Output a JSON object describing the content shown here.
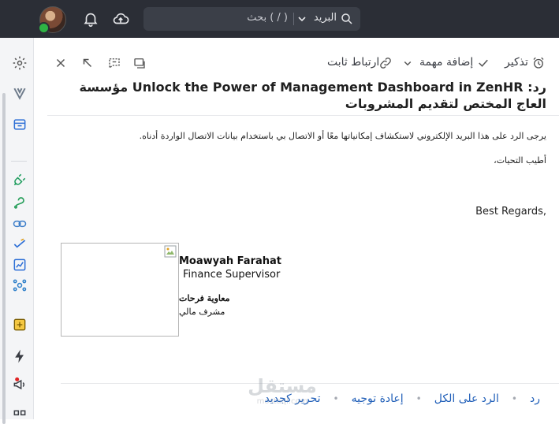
{
  "topbar": {
    "search_placeholder": "بحث ( / )",
    "search_scope": "البريد"
  },
  "toolbar": {
    "reminder_label": "تذكير",
    "add_task_label": "إضافة مهمة",
    "permalink_label": "ارتباط ثابت"
  },
  "email": {
    "subject": "رد: Unlock the Power of Management Dashboard in ZenHR مؤسسة العاج المختص لتقديم المشروبات",
    "body_paragraph": "يرجى الرد على هذا البريد الإلكتروني لاستكشاف إمكانياتها معًا أو الاتصال بي باستخدام بيانات الاتصال الواردة أدناه.",
    "closing_ar": "أطيب التحيات،",
    "closing_en": "Best Regards,",
    "signature": {
      "name_en": "Moawyah Farahat",
      "title_en": "Finance Supervisor",
      "name_ar": "معاوية فرحات",
      "title_ar": "مشرف مالي"
    }
  },
  "actions": {
    "reply": "رد",
    "reply_all": "الرد على الكل",
    "forward": "إعادة توجيه",
    "edit_as_new": "تحرير كجديد"
  },
  "watermark": {
    "arabic": "مستقل",
    "latin": "mostaql.com"
  },
  "colors": {
    "topbar_bg": "#2b2e36",
    "link_blue": "#1f5eb8",
    "online_green": "#2fb344",
    "notification_red": "#e02424"
  }
}
